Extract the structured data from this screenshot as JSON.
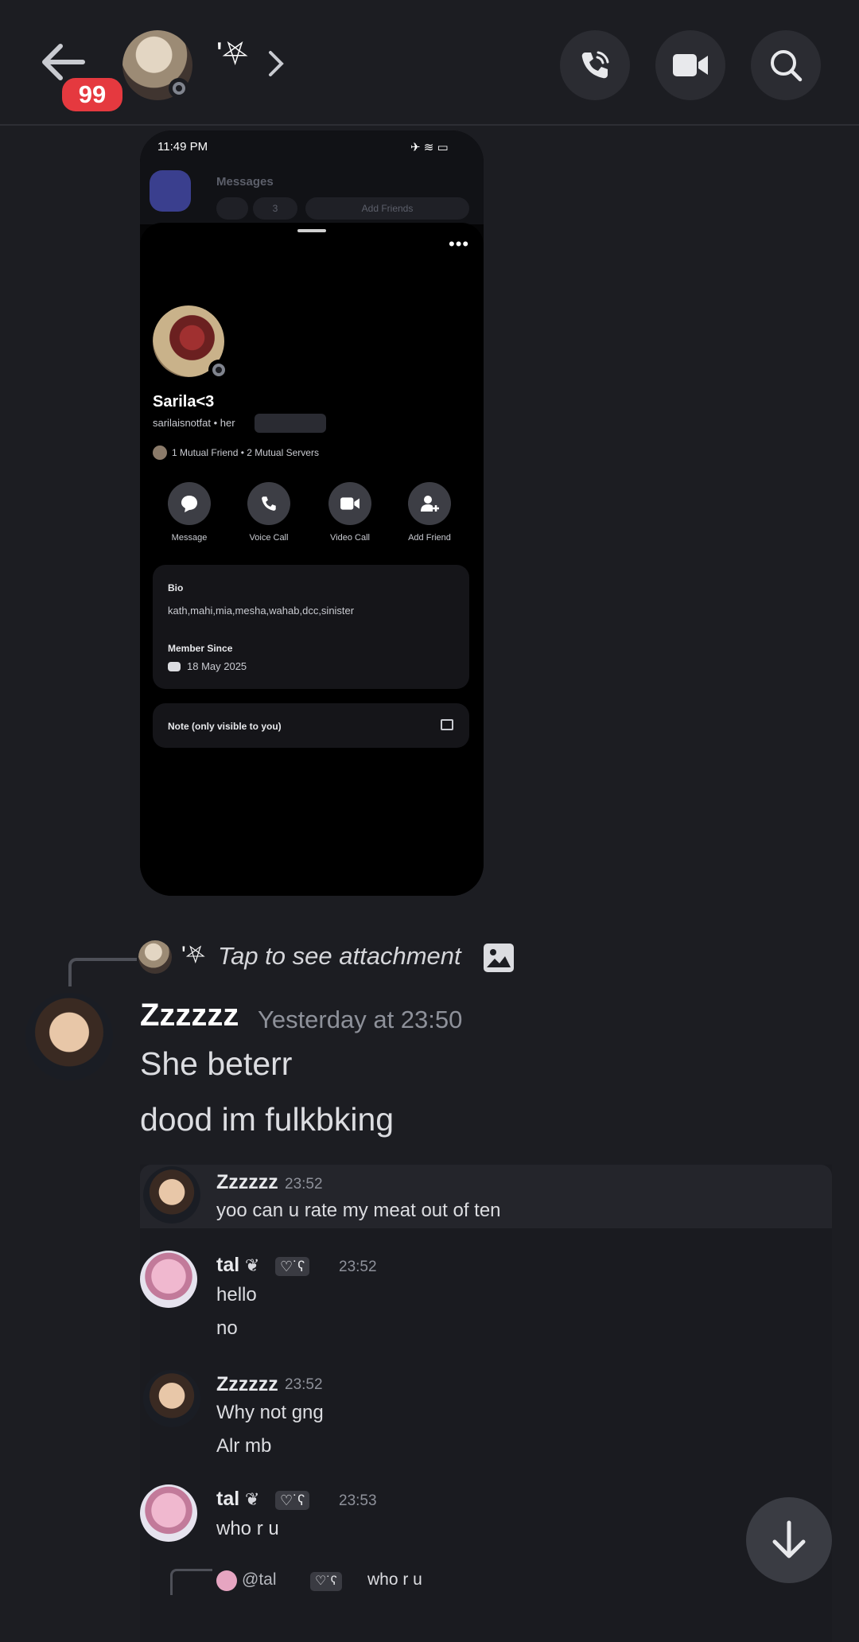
{
  "header": {
    "unread_count": "99",
    "channel_name": "'⛧",
    "icons": [
      "back-arrow-icon",
      "phone-icon",
      "video-icon",
      "search-icon",
      "chevron-right-icon"
    ]
  },
  "attachment_screenshot": {
    "status_bar": {
      "time": "11:49 PM"
    },
    "messages_label": "Messages",
    "inbox_count": "3",
    "add_friends": "Add Friends",
    "profile": {
      "display_name": "Sarila<3",
      "username_line": "sarilaisnotfat • her",
      "mutuals": "1 Mutual Friend  •  2 Mutual Servers",
      "actions": [
        "Message",
        "Voice Call",
        "Video Call",
        "Add Friend"
      ],
      "bio_heading": "Bio",
      "bio_text": "kath,mahi,mia,mesha,wahab,dcc,sinister",
      "member_since_heading": "Member Since",
      "member_since_date": "18 May 2025",
      "note_label": "Note (only visible to you)"
    }
  },
  "reply_preview": {
    "author_symbol": "'⛧",
    "text": "Tap to see attachment"
  },
  "message": {
    "author": "Zzzzzz",
    "timestamp": "Yesterday at 23:50",
    "lines": [
      "She beterr",
      "dood im fulkbking"
    ]
  },
  "forwarded": [
    {
      "author": "Zzzzzz",
      "time": "23:52",
      "lines": [
        "yoo can u rate my meat out of ten"
      ],
      "tag": ""
    },
    {
      "author": "tal",
      "time": "23:52",
      "lines": [
        "hello",
        "no"
      ],
      "tag": "♡˙ʕ"
    },
    {
      "author": "Zzzzzz",
      "time": "23:52",
      "lines": [
        "Why not gng",
        "Alr mb"
      ],
      "tag": ""
    },
    {
      "author": "tal",
      "time": "23:53",
      "lines": [
        "who r u"
      ],
      "tag": "♡˙ʕ"
    }
  ],
  "reply_bottom": {
    "mention": "@tal",
    "tag": "♡˙ʕ",
    "text": "who r u"
  }
}
